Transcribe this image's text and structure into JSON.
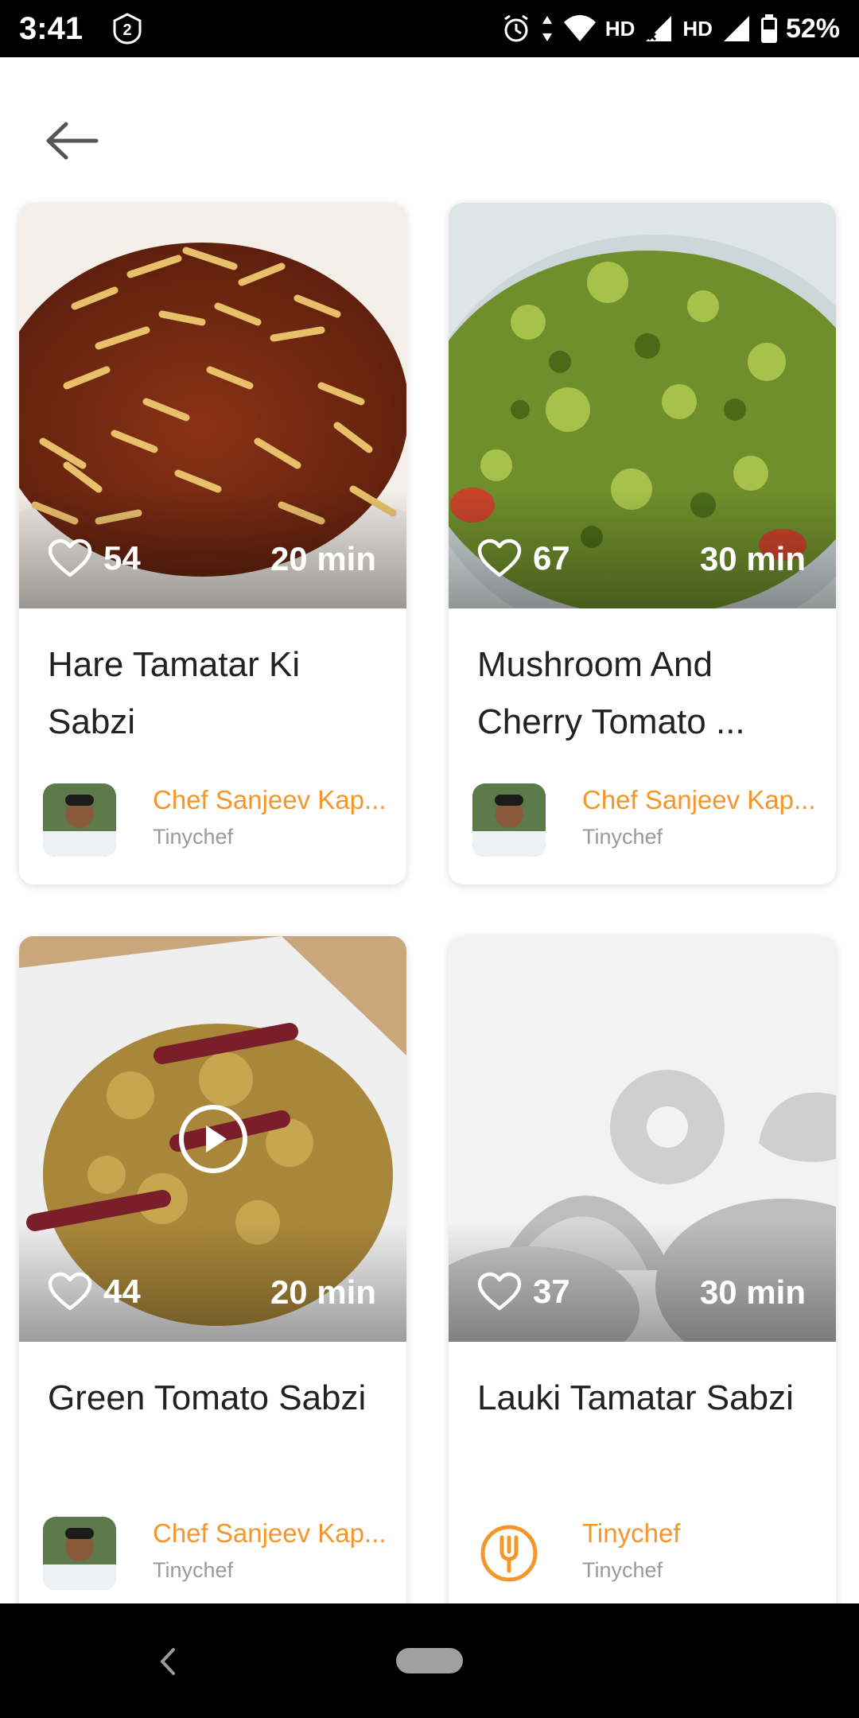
{
  "status_bar": {
    "time": "3:41",
    "badge": "2",
    "net1": "HD",
    "net2": "HD",
    "battery": "52%"
  },
  "recipes": [
    {
      "likes": "54",
      "duration": "20 min",
      "title": "Hare Tamatar Ki Sabzi",
      "chef": "Chef Sanjeev Kap...",
      "source": "Tinychef",
      "has_video": false
    },
    {
      "likes": "67",
      "duration": "30 min",
      "title": "Mushroom And Cherry Tomato ...",
      "chef": "Chef Sanjeev Kap...",
      "source": "Tinychef",
      "has_video": false
    },
    {
      "likes": "44",
      "duration": "20 min",
      "title": "Green Tomato Sabzi",
      "chef": "Chef Sanjeev Kap...",
      "source": "Tinychef",
      "has_video": true
    },
    {
      "likes": "37",
      "duration": "30 min",
      "title": "Lauki Tamatar Sabzi",
      "chef": "Tinychef",
      "source": "Tinychef",
      "has_video": false
    }
  ],
  "colors": {
    "accent": "#f5962a",
    "chef_name": "#f5962a",
    "subtitle": "#9a9a9a",
    "title": "#222222"
  },
  "icons": {
    "back": "arrow-left-icon",
    "like": "heart-outline-icon",
    "play": "play-circle-icon",
    "tinychef_logo": "fork-circle-icon"
  }
}
